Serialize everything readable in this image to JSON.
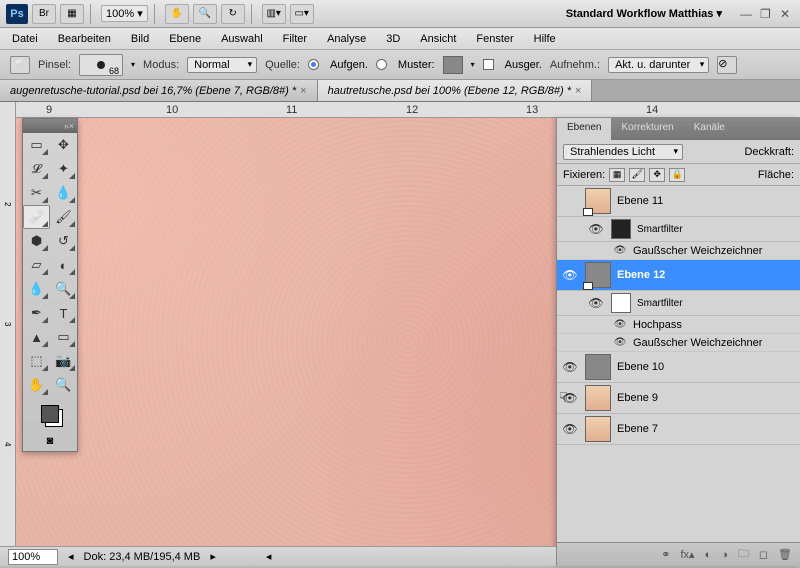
{
  "topbar": {
    "zoom": "100% ▾",
    "workspace": "Standard Workflow Matthias ▾"
  },
  "menu": [
    "Datei",
    "Bearbeiten",
    "Bild",
    "Ebene",
    "Auswahl",
    "Filter",
    "Analyse",
    "3D",
    "Ansicht",
    "Fenster",
    "Hilfe"
  ],
  "options": {
    "brush_label": "Pinsel:",
    "brush_size": "68",
    "mode_label": "Modus:",
    "mode_value": "Normal",
    "source_label": "Quelle:",
    "src_sampled": "Aufgen.",
    "src_pattern": "Muster:",
    "aligned": "Ausger.",
    "sample_label": "Aufnehm.:",
    "sample_value": "Akt. u. darunter"
  },
  "tabs": [
    {
      "title": "augenretusche-tutorial.psd bei 16,7% (Ebene 7, RGB/8#) *",
      "active": false
    },
    {
      "title": "hautretusche.psd bei 100% (Ebene 12, RGB/8#) *",
      "active": true
    }
  ],
  "ruler_h": [
    "9",
    "10",
    "11",
    "12",
    "13",
    "14"
  ],
  "ruler_v": [
    "2",
    "3",
    "4"
  ],
  "panel": {
    "tabs": [
      "Ebenen",
      "Korrekturen",
      "Kanäle"
    ],
    "blend": "Strahlendes Licht",
    "opacity_label": "Deckkraft:",
    "lock_label": "Fixieren:",
    "fill_label": "Fläche:",
    "layers": [
      {
        "name": "Ebene 11",
        "eye": false,
        "thumb": "face",
        "mask": true
      },
      {
        "name": "Smartfilter",
        "sub": true,
        "eye": true,
        "thumb": "face"
      },
      {
        "name": "Gaußscher Weichzeichner",
        "filter": true,
        "eye": true
      },
      {
        "name": "Ebene 12",
        "eye": true,
        "sel": true,
        "thumb": "grey",
        "mask": true
      },
      {
        "name": "Smartfilter",
        "sub": true,
        "eye": true,
        "thumb": "white"
      },
      {
        "name": "Hochpass",
        "filter": true,
        "eye": true
      },
      {
        "name": "Gaußscher Weichzeichner",
        "filter": true,
        "eye": true
      },
      {
        "name": "Ebene 10",
        "eye": true,
        "thumb": "grey"
      },
      {
        "name": "Ebene 9",
        "eye": true,
        "thumb": "face"
      },
      {
        "name": "Ebene 7",
        "eye": true,
        "thumb": "face"
      }
    ]
  },
  "status": {
    "zoom": "100%",
    "doc": "Dok: 23,4 MB/195,4 MB"
  }
}
